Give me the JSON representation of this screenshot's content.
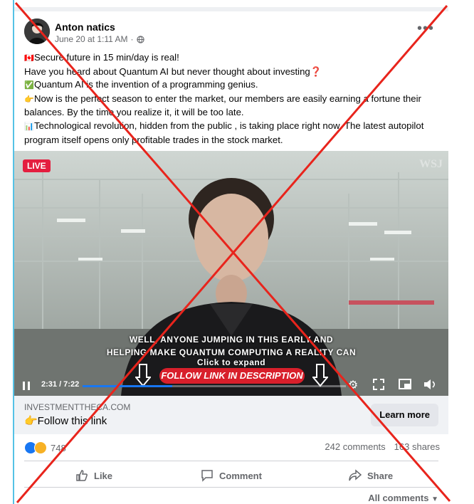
{
  "post": {
    "author": "Anton natics",
    "date": "June 20 at 1:11 AM",
    "dot": "·",
    "more_label": "•••",
    "lines": [
      {
        "emoji": "🇨🇦",
        "text": "Secure future in 15 min/day is real!"
      },
      {
        "emoji": "",
        "text": "Have you heard about Quantum AI but never thought about investing❓"
      },
      {
        "emoji": "✅",
        "text": "Quantum AI is the invention of a programming genius."
      },
      {
        "emoji": "👉",
        "text": "Now is the perfect season to enter the market, our members are easily earning a fortune their"
      },
      {
        "emoji": "",
        "text": "balances. By the time you realize it, it will be too late."
      },
      {
        "emoji": "📊",
        "text": "Technological revolution, hidden from the public , is taking place right now. The latest autopilot"
      },
      {
        "emoji": "",
        "text": "program itself opens only profitable trades in the stock market."
      }
    ]
  },
  "video": {
    "live_label": "LIVE",
    "watermark": "WSJ",
    "caption_line1": "WELL, ANYONE JUMPING IN THIS EARLY AND",
    "caption_line2": "HELPING MAKE QUANTUM COMPUTING A REALITY CAN",
    "expand_label": "Click to expand",
    "follow_pill": "FOLLOW LINK IN DESCRIPTION",
    "time": "2:31 / 7:22",
    "progress": 0.34
  },
  "link_preview": {
    "domain": "INVESTMENTTHECA.COM",
    "title": "👉Follow this link",
    "button": "Learn more"
  },
  "engagement": {
    "reaction_count": "748",
    "comments": "242 comments",
    "shares": "163 shares"
  },
  "actions": {
    "like": "Like",
    "comment": "Comment",
    "share": "Share",
    "all_comments": "All comments"
  },
  "colors": {
    "cross": "#e8241c",
    "accent": "#1877f2",
    "live": "#e41e3f"
  }
}
